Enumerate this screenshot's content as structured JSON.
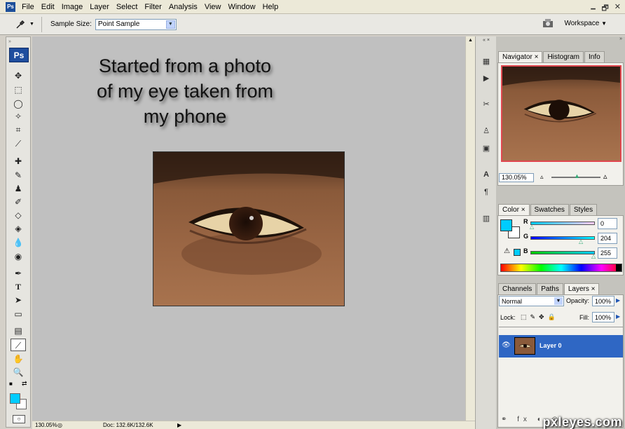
{
  "menubar": {
    "app_icon": "Ps",
    "items": [
      "File",
      "Edit",
      "Image",
      "Layer",
      "Select",
      "Filter",
      "Analysis",
      "View",
      "Window",
      "Help"
    ]
  },
  "options_bar": {
    "tool_icon": "eyedropper-icon",
    "sample_size_label": "Sample Size:",
    "sample_size_value": "Point Sample",
    "workspace_label": "Workspace"
  },
  "toolbox": {
    "logo": "Ps",
    "tools": [
      "move",
      "marquee",
      "lasso",
      "magic-wand",
      "crop",
      "slice",
      "healing",
      "brush",
      "clone-stamp",
      "history-brush",
      "eraser",
      "paint-bucket",
      "blur",
      "dodge",
      "pen",
      "type",
      "path-select",
      "shape",
      "notes",
      "eyedropper",
      "hand",
      "zoom"
    ],
    "foreground_color": "#00ccff",
    "background_color": "#ffffff"
  },
  "canvas": {
    "text_lines": [
      "Started from a photo",
      "of my eye taken from",
      "my phone"
    ],
    "background_color": "#c0c0c0"
  },
  "status_bar": {
    "zoom": "130.05%",
    "doc": "Doc: 132.6K/132.6K"
  },
  "navigator": {
    "tabs": [
      "Navigator",
      "Histogram",
      "Info"
    ],
    "zoom": "130.05%"
  },
  "color_panel": {
    "tabs": [
      "Color",
      "Swatches",
      "Styles"
    ],
    "r_label": "R",
    "r": "0",
    "g_label": "G",
    "g": "204",
    "b_label": "B",
    "b": "255",
    "color": "#00ccff"
  },
  "layers_panel": {
    "tabs": [
      "Channels",
      "Paths",
      "Layers"
    ],
    "blend_mode": "Normal",
    "opacity_label": "Opacity:",
    "opacity": "100%",
    "lock_label": "Lock:",
    "fill_label": "Fill:",
    "fill": "100%",
    "layers": [
      {
        "name": "Layer 0",
        "selected": true
      }
    ]
  },
  "watermark": "pxleyes.com"
}
